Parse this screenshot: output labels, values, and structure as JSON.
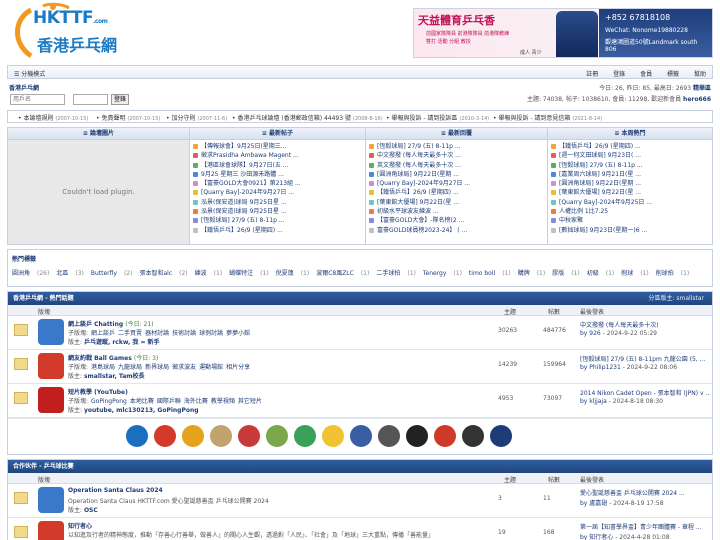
{
  "header": {
    "logo_text": "HKTTF",
    "logo_suffix": ".com",
    "logo_cn": "香港乒乓網",
    "banner": {
      "title": "天益體育乒乓香",
      "line1": "前國家隊隊員  前港隊隊員  前港隊教練",
      "line2": "雙打   活動   分組   教授",
      "line3": "成人 青少",
      "phone": "+852 67818108",
      "wechat": "WeChat: Nonome19880228",
      "addr1": "觀塘鴻圖道50號Landmark south",
      "addr2": "806"
    }
  },
  "navbar": {
    "menu": "分機模式",
    "links": [
      "註冊",
      "登錄",
      "會員",
      "標籤",
      "幫助"
    ]
  },
  "crumb": {
    "home": "香港乒乓網",
    "stats": "今日: 26, 昨日: 85, 最高日: 2693",
    "stats_link": "精華區"
  },
  "login": {
    "username_placeholder": "用戶名",
    "button": "登錄",
    "info": "主題: 74038, 帖子: 1038610, 會員: 11298, 歡迎新會員 ",
    "new_member": "hero666"
  },
  "notices": [
    {
      "text": "本論壇規則",
      "date": "(2007-10-15)"
    },
    {
      "text": "免責聲明",
      "date": "(2007-10-15)"
    },
    {
      "text": "加分守則",
      "date": "(2007-11-6)"
    },
    {
      "text": "香港乒乓球論壇 (香港郵政信箱) 44493 號",
      "date": "(2008-8-16)"
    },
    {
      "text": "舉報與投訴 - 請到投訴區",
      "date": "(2010-3-14)"
    },
    {
      "text": "舉報與投訴 - 請到意見信箱",
      "date": "(2021-8-14)"
    }
  ],
  "columns": {
    "pics": "論壇圖片",
    "newest": "最新帖子",
    "reply": "最新回覆",
    "hot": "本周熱門",
    "plugin": "Couldn't load plugin."
  },
  "newest_list": [
    "【傳報球會】9月25日(星期三...",
    "徵求Prasidha Ambawa Magent ...",
    "【港區球會球隊】9月27日(五 ...",
    "9月25 星期三 沙田源禾路體 ...",
    "【富豪GOLD大會0921】第213組 ...",
    "[Quarry Bay]-2024年9月27日 ...",
    "泓景(保安道)球局 9月25日星 ...",
    "泓景(保安道)球局 9月25日星 ...",
    "[恆毅球局] 27/9 (五) 8-11p ...",
    "【鐵悟乒乓】26/9 (星期四) ..."
  ],
  "reply_list": [
    "[恆毅球局] 27/9 (五) 8-11p ...",
    "中文撥撥 (每人每天最多十次 ...",
    "英文撥撥 (每人每天最多十次 ...",
    "[圓洲角球局] 9月22日(星期 ...",
    "[Quarry Bay]-2024年9月27日 ...",
    "【鐵悟乒乓】26/9 (星期四) ...",
    "[葉東館大優場] 9月22日(星 ...",
    "初級水平球波友練波 ...",
    "【富豪GOLD大會】-隊名榜(2 ...",
    "富豪GOLD球員榜2023-24】 ( ..."
  ],
  "hot_list": [
    "【鐵悟乒乓】26/9 (星期四) ...",
    "[週一何文田球局] 9月23日( ...",
    "[恆毅球局] 27/9 (五) 8-11p ...",
    "[嘉業周六球局] 9月21日(星 ...",
    "[圓洲角球局] 9月22日(星期 ...",
    "[葉東館大優場] 9月22日(星 ...",
    "[Quarry Bay]-2024年9月25日 ...",
    "人權比例 1比7.25",
    "中秋家聚",
    "[數拙球局] 9月23日(星期一)6 ..."
  ],
  "hot_tags": {
    "title": "熱門標籤",
    "tags": [
      {
        "name": "圓洲角",
        "count": "(26)"
      },
      {
        "name": "北區",
        "count": "(3)"
      },
      {
        "name": "Butterfly",
        "count": "(2)"
      },
      {
        "name": "張本智和alc",
        "count": "(2)"
      },
      {
        "name": "練波",
        "count": "(1)"
      },
      {
        "name": "蝴蝶特注",
        "count": "(1)"
      },
      {
        "name": "倪夏蓮",
        "count": "(1)"
      },
      {
        "name": "波爾C8風ZLC",
        "count": "(1)"
      },
      {
        "name": "二手球拍",
        "count": "(1)"
      },
      {
        "name": "Tenergy",
        "count": "(1)"
      },
      {
        "name": "timo boll",
        "count": "(1)"
      },
      {
        "name": "購牌",
        "count": "(1)"
      },
      {
        "name": "膠版",
        "count": "(1)"
      },
      {
        "name": "初級",
        "count": "(1)"
      },
      {
        "name": "削球",
        "count": "(1)"
      },
      {
        "name": "削球拍",
        "count": "(1)"
      }
    ]
  },
  "section_hot": {
    "title": "香港乒乓網 - 熱門話題",
    "moderator": "分區版主: smallstar",
    "cols": [
      "版塊",
      "主題",
      "帖數",
      "最後發表"
    ],
    "forums": [
      {
        "name": "網上談乒 Chatting",
        "today": "(今日: 21)",
        "sub_label": "子版塊:",
        "subs": [
          "網上談乒",
          "二手買賣",
          "器材討論",
          "技術討論",
          "球例討論",
          "夢夢小館"
        ],
        "mod_label": "版主:",
        "mods": "乒乓遊蹤, rckw, 我 = 新手",
        "threads": "30263",
        "posts": "484776",
        "last": "中文撥撥 (每人每天最多十次)",
        "last_by": "by 926",
        "last_time": " - 2024-9-22 05:29"
      },
      {
        "name": "網友約戰 Ball Games",
        "today": "(今日: 3)",
        "sub_label": "子版塊:",
        "subs": [
          "港島球局",
          "九龍球局",
          "新界球局",
          "徵求波友",
          "運動場館",
          "相片分享"
        ],
        "mod_label": "版主:",
        "mods": "smallstar, Tam校長",
        "threads": "14239",
        "posts": "159964",
        "last": "[恆毅球局] 27/9 (五) 8-11pm 九龍公園 (5, ...",
        "last_by": "by Philip1231",
        "last_time": " - 2024-9-22 08:06"
      },
      {
        "name": "短片教學 (YouTube)",
        "today": "",
        "sub_label": "子版塊:",
        "subs": [
          "GoPingPong",
          "本地比賽",
          "國際乒聯",
          "海外比賽",
          "教學視頻",
          "其它短片"
        ],
        "mod_label": "版主:",
        "mods": "youtube, mlc130213, GoPingPong",
        "threads": "4953",
        "posts": "73097",
        "last": "2014 Nikon Cadet Open - 張本智和 (JPN) v ...",
        "last_by": "by kljjaja",
        "last_time": " - 2024-8-18 08:30"
      }
    ]
  },
  "section_partners": {
    "title": "合作伙伴 - 乒乓球比賽",
    "cols": [
      "版塊",
      "主題",
      "帖數",
      "最後發表"
    ],
    "forums": [
      {
        "name": "Operation Santa Claus 2024",
        "desc": "Operation Santa Claus HKTTF.com 愛心聖誕慈善盃 乒乓球公開賽 2024",
        "mod_label": "版主:",
        "mods": "OSC",
        "threads": "3",
        "posts": "11",
        "last": "愛心聖誕慈善盃 乒乓球公開賽 2024 ...",
        "last_by": "by 盧嘉翅",
        "last_time": " - 2024-8-19 17:58"
      },
      {
        "name": "知行者心",
        "desc": "以知進及行者的精神態度，推動「存善心行善舉，做善人」的關心人生觀，透過對「人民」、「社會」及「地球」三大重點，傳播「善能量」",
        "mod_label": "",
        "mods": "",
        "threads": "19",
        "posts": "168",
        "last": "第一屆【知書學界盃】青少年團體賽 - 章程 ...",
        "last_by": "by 知行者心",
        "last_time": " - 2024-4-28 01:08"
      }
    ]
  }
}
